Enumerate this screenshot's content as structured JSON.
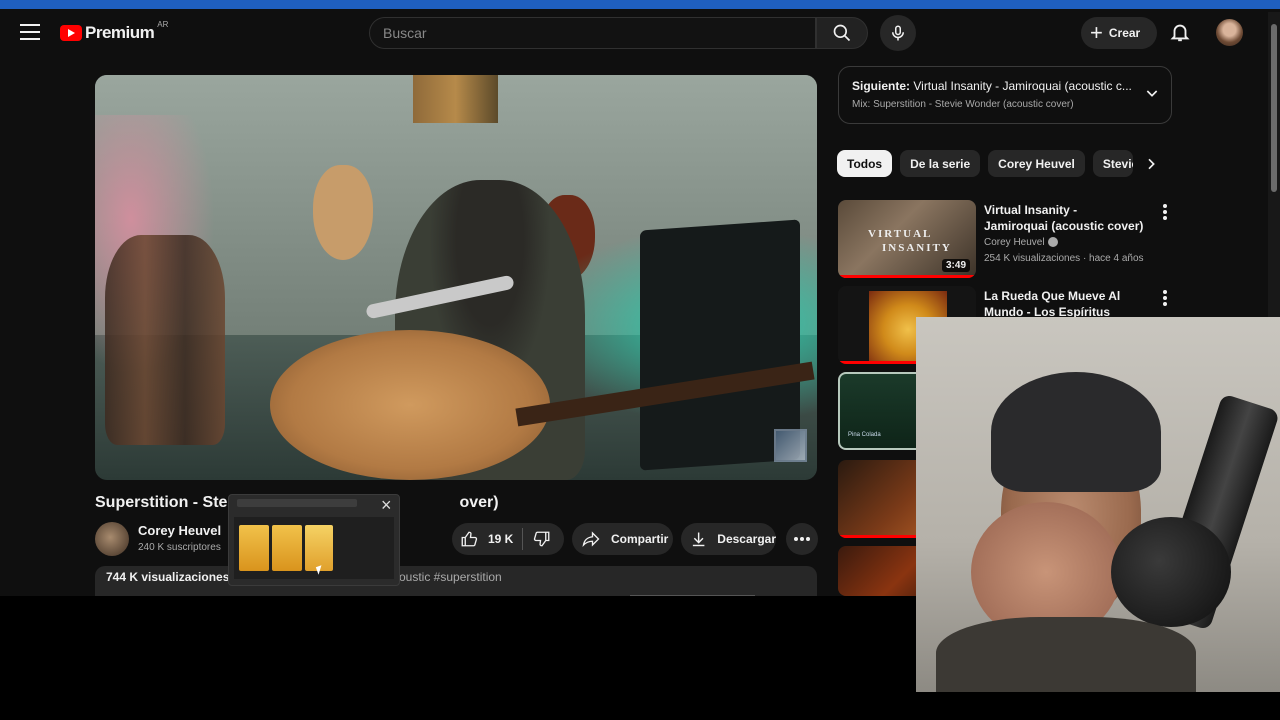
{
  "masthead": {
    "logo_text": "Premium",
    "region": "AR",
    "search_placeholder": "Buscar",
    "create_label": "Crear"
  },
  "video": {
    "title_start": "Superstition - Ste",
    "title_end": "over)",
    "channel_name": "Corey Heuvel",
    "subscribers": "240 K suscriptores",
    "likes": "19 K",
    "share_label": "Compartir",
    "download_label": "Descargar",
    "views": "744 K visualizaciones",
    "tags": "oustic #superstition"
  },
  "up_next": {
    "prefix": "Siguiente:",
    "title": "Virtual Insanity - Jamiroquai (acoustic c...",
    "mix": "Mix: Superstition - Stevie Wonder (acoustic cover)"
  },
  "chips": [
    "Todos",
    "De la serie",
    "Corey Heuvel",
    "Stevie"
  ],
  "recommendations": [
    {
      "title": "Virtual Insanity - Jamiroquai (acoustic cover)",
      "channel": "Corey Heuvel",
      "meta": "254 K visualizaciones · hace 4 años",
      "duration": "3:49",
      "thumb_text_1": "VIRTUAL",
      "thumb_text_2": "INSANITY"
    },
    {
      "title": "La Rueda Que Mueve Al Mundo - Los Espíritus"
    }
  ],
  "thumb3_caption": "Pina Colada",
  "colors": {
    "accent": "#ff0000",
    "background": "#0f0f0f",
    "chip_bg": "#272727",
    "taskbar_strip": "#1f5fbf"
  },
  "icons": [
    "menu-icon",
    "youtube-logo-icon",
    "search-icon",
    "microphone-icon",
    "plus-icon",
    "bell-icon",
    "like-icon",
    "dislike-icon",
    "share-icon",
    "download-icon",
    "more-horizontal-icon",
    "chevron-down-icon",
    "chevron-right-icon",
    "more-vertical-icon",
    "close-icon"
  ]
}
